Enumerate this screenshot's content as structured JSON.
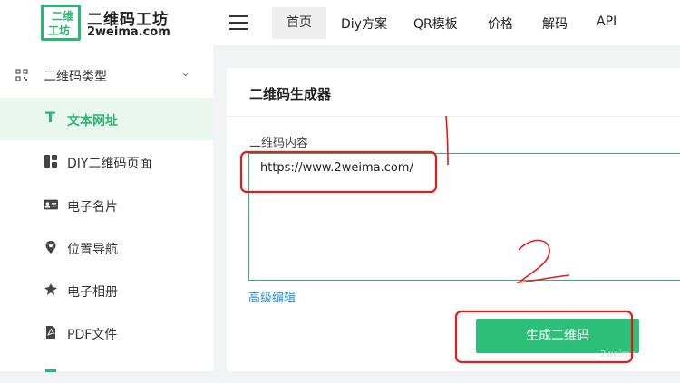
{
  "brand": {
    "logo_top": "二维",
    "logo_bottom": "工坊",
    "title": "二维码工坊",
    "subtitle": "2weima.com"
  },
  "sidebar": {
    "group_label": "二维码类型",
    "items": [
      {
        "label": "文本网址",
        "icon": "text-icon",
        "active": true
      },
      {
        "label": "DIY二维码页面",
        "icon": "layout-icon"
      },
      {
        "label": "电子名片",
        "icon": "id-card-icon"
      },
      {
        "label": "位置导航",
        "icon": "location-pin-icon"
      },
      {
        "label": "电子相册",
        "icon": "photo-album-icon"
      },
      {
        "label": "PDF文件",
        "icon": "pdf-file-icon"
      }
    ]
  },
  "nav": {
    "items": [
      {
        "label": "首页",
        "active": true
      },
      {
        "label": "Diy方案"
      },
      {
        "label": "QR模板"
      },
      {
        "label": "价格"
      },
      {
        "label": "解码"
      },
      {
        "label": "API"
      }
    ]
  },
  "panel": {
    "title": "二维码生成器",
    "field_label": "二维码内容",
    "content_value": "https://www.2weima.com/",
    "advanced_link": "高级编辑",
    "generate_button": "生成二维码"
  },
  "annotations": {
    "marker_one": "1",
    "marker_two": "2"
  },
  "colors": {
    "brand_green": "#2bb673",
    "button_green": "#2bbf78",
    "annotation_red": "#e21b1b",
    "link_blue": "#2a8ecf"
  }
}
